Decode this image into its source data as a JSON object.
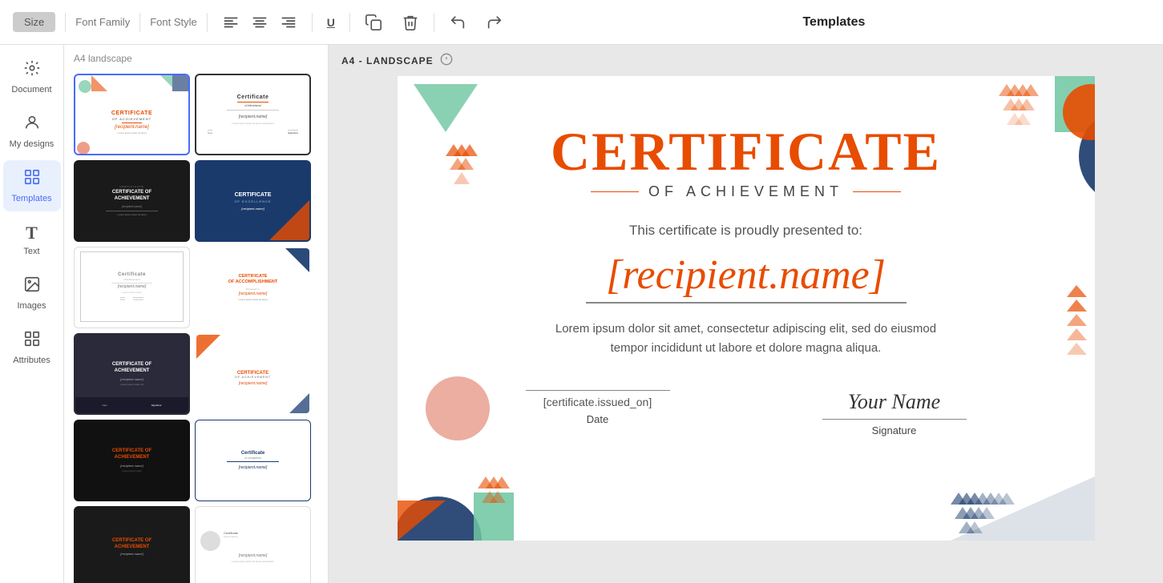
{
  "toolbar": {
    "title": "Templates",
    "size_label": "Size",
    "font_family_label": "Font Family",
    "font_style_label": "Font Style",
    "align_left": "Align Left",
    "align_center": "Align Center",
    "align_right": "Align Right",
    "underline": "U",
    "copy": "Copy",
    "delete": "Delete",
    "undo": "Undo",
    "redo": "Redo"
  },
  "sidebar": {
    "items": [
      {
        "id": "document",
        "label": "Document",
        "icon": "⚙"
      },
      {
        "id": "my-designs",
        "label": "My designs",
        "icon": "👤"
      },
      {
        "id": "templates",
        "label": "Templates",
        "icon": "⊞",
        "active": true
      },
      {
        "id": "text",
        "label": "Text",
        "icon": "T"
      },
      {
        "id": "images",
        "label": "Images",
        "icon": "🖼"
      },
      {
        "id": "attributes",
        "label": "Attributes",
        "icon": "≡"
      }
    ]
  },
  "templates_panel": {
    "header": "A4 landscape",
    "templates": [
      {
        "id": 1,
        "style": "geo-white",
        "title": "CERTIFICATE",
        "color": "#e84c00"
      },
      {
        "id": 2,
        "style": "classic-white",
        "title": "Certificate",
        "color": "#555"
      },
      {
        "id": 3,
        "style": "simple-white",
        "title": "Certificate",
        "color": "#555"
      },
      {
        "id": 4,
        "style": "black-dark",
        "title": "CERTIFICATE OF ACHIEVEMENT",
        "color": "#fff"
      },
      {
        "id": 5,
        "style": "navy-blue",
        "title": "CERTIFICATE",
        "color": "#fff"
      },
      {
        "id": 6,
        "style": "elegant-white",
        "title": "Certificate",
        "color": "#888"
      },
      {
        "id": 7,
        "style": "accomplishment",
        "title": "CERTIFICATE OF ACCOMPLISHMENT",
        "color": "#e84c00"
      },
      {
        "id": 8,
        "style": "dark-footer",
        "title": "CERTIFICATE OF ACHIEVEMENT",
        "color": "#fff"
      },
      {
        "id": 9,
        "style": "geo-orange",
        "title": "CERTIFICATE",
        "color": "#e84c00"
      },
      {
        "id": 10,
        "style": "dark2",
        "title": "CERTIFICATE OF ACHIEVEMENT",
        "color": "#e84c00"
      },
      {
        "id": 11,
        "style": "blue2",
        "title": "Certificate",
        "color": "#1a3a6b"
      }
    ]
  },
  "canvas": {
    "header_label": "A4 - LANDSCAPE",
    "certificate": {
      "title": "CERTIFICATE",
      "subtitle": "OF ACHIEVEMENT",
      "presented_text": "This certificate is proudly presented to:",
      "recipient": "[recipient.name]",
      "body_text": "Lorem ipsum dolor sit amet, consectetur adipiscing elit,\nsed do eiusmod tempor incididunt ut labore et dolore\nmagna aliqua.",
      "issued_on": "[certificate.issued_on]",
      "date_label": "Date",
      "signature_text": "Your Name",
      "signature_label": "Signature"
    }
  }
}
